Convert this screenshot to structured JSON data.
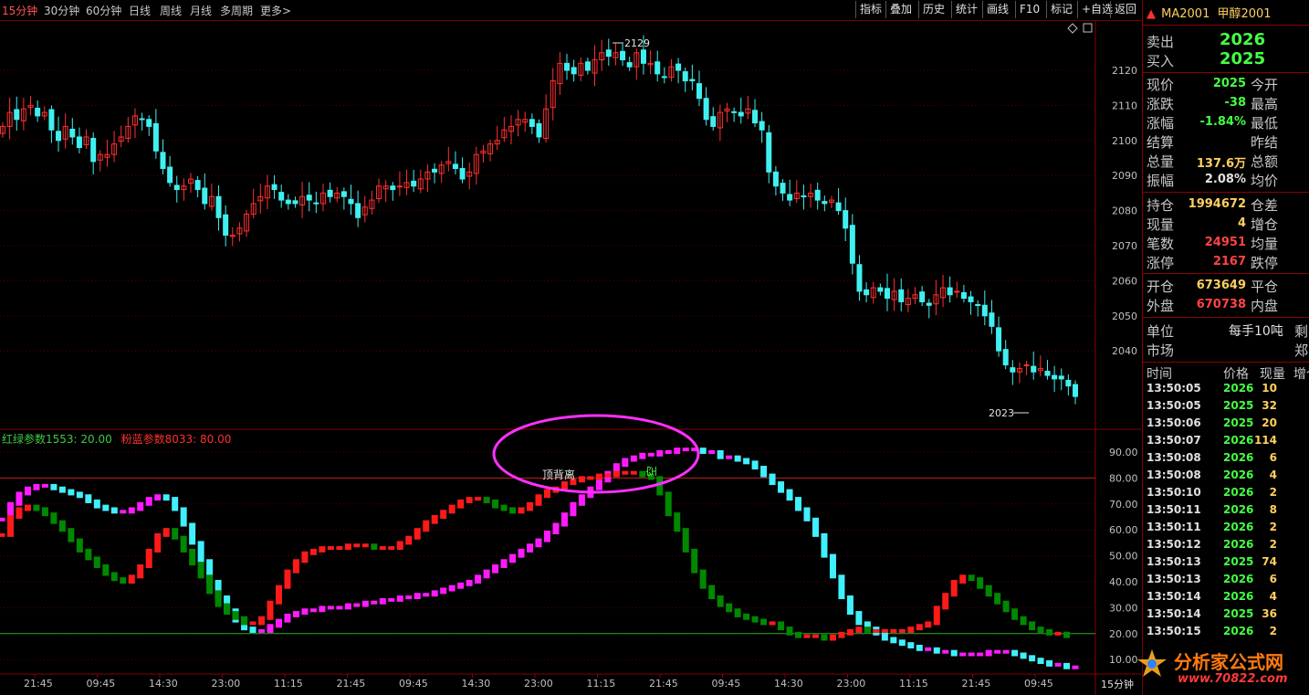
{
  "topbar": {
    "periods": [
      "15分钟",
      "30分钟",
      "60分钟",
      "日线",
      "周线",
      "月线",
      "多周期",
      "更多>"
    ],
    "tools": [
      "指标",
      "叠加",
      "历史",
      "统计",
      "画线",
      "F10",
      "标记",
      "+自选",
      "返回"
    ]
  },
  "symbol": {
    "code": "MA2001",
    "name": "甲醇2001"
  },
  "quote": {
    "sell_label": "卖出",
    "sell": "2026",
    "buy_label": "买入",
    "buy": "2025",
    "rows1": [
      {
        "l": "现价",
        "v": "2025",
        "c": "#44ff44",
        "r": "今开"
      },
      {
        "l": "涨跌",
        "v": "-38",
        "c": "#44ff44",
        "r": "最高"
      },
      {
        "l": "涨幅",
        "v": "-1.84%",
        "c": "#44ff44",
        "r": "最低"
      },
      {
        "l": "结算",
        "v": "",
        "c": "#c8c8c8",
        "r": "昨结"
      },
      {
        "l": "总量",
        "v": "137.6万",
        "c": "#ffd060",
        "r": "总额"
      },
      {
        "l": "振幅",
        "v": "2.08%",
        "c": "#e0e0e0",
        "r": "均价"
      }
    ],
    "rows2": [
      {
        "l": "持仓",
        "v": "1994672",
        "c": "#ffd060",
        "r": "仓差"
      },
      {
        "l": "现量",
        "v": "4",
        "c": "#ffd060",
        "r": "增仓"
      },
      {
        "l": "笔数",
        "v": "24951",
        "c": "#ff4444",
        "r": "均量"
      },
      {
        "l": "涨停",
        "v": "2167",
        "c": "#ff4444",
        "r": "跌停"
      }
    ],
    "rows3": [
      {
        "l": "开仓",
        "v": "673649",
        "c": "#ffd060",
        "r": "平仓"
      },
      {
        "l": "外盘",
        "v": "670738",
        "c": "#ff4444",
        "r": "内盘"
      }
    ],
    "unit_label": "单位",
    "unit_value": "每手10吨",
    "unit_right": "剩",
    "market_label": "市场",
    "market_value": "郑"
  },
  "ticks": {
    "headers": [
      "时间",
      "价格",
      "现量",
      "增仓"
    ],
    "rows": [
      {
        "t": "13:50:05",
        "p": "2026",
        "q": "10"
      },
      {
        "t": "13:50:05",
        "p": "2025",
        "q": "32"
      },
      {
        "t": "13:50:06",
        "p": "2025",
        "q": "20"
      },
      {
        "t": "13:50:07",
        "p": "2026",
        "q": "114"
      },
      {
        "t": "13:50:08",
        "p": "2026",
        "q": "6"
      },
      {
        "t": "13:50:08",
        "p": "2026",
        "q": "4"
      },
      {
        "t": "13:50:10",
        "p": "2026",
        "q": "2"
      },
      {
        "t": "13:50:11",
        "p": "2026",
        "q": "8"
      },
      {
        "t": "13:50:11",
        "p": "2026",
        "q": "2"
      },
      {
        "t": "13:50:12",
        "p": "2026",
        "q": "2"
      },
      {
        "t": "13:50:13",
        "p": "2025",
        "q": "74"
      },
      {
        "t": "13:50:13",
        "p": "2026",
        "q": "6"
      },
      {
        "t": "13:50:14",
        "p": "2026",
        "q": "4"
      },
      {
        "t": "13:50:14",
        "p": "2025",
        "q": "36"
      },
      {
        "t": "13:50:15",
        "p": "2026",
        "q": "2"
      }
    ]
  },
  "price_axis": [
    "2120",
    "2110",
    "2100",
    "2090",
    "2080",
    "2070",
    "2060",
    "2050",
    "2040"
  ],
  "indicator_axis": [
    "90.00",
    "80.00",
    "70.00",
    "60.00",
    "50.00",
    "40.00",
    "30.00",
    "20.00",
    "10.00"
  ],
  "time_axis": [
    "21:45",
    "09:45",
    "14:30",
    "23:00",
    "11:15",
    "21:45",
    "09:45",
    "14:30",
    "23:00",
    "11:15",
    "21:45",
    "09:45",
    "14:30",
    "23:00",
    "11:15",
    "21:45",
    "09:45"
  ],
  "time_axis_right": "15分钟",
  "annotations": {
    "high": "2129",
    "low": "2023",
    "divergence": "顶背离",
    "short": "空"
  },
  "indicator_title": {
    "part1": "红绿参数1553: 20.00",
    "part2": "粉蓝参数8033: 80.00"
  },
  "watermark": {
    "text": "分析家公式网",
    "url": "www.70822.com"
  },
  "colors": {
    "up": "#ff3030",
    "down": "#40f0f0",
    "red": "#ff1a1a",
    "green": "#008800",
    "magenta": "#ff1aff",
    "cyan": "#40f0ff",
    "grid": "#5a0000"
  },
  "chart_data": {
    "type": "candlestick",
    "ylim": [
      2023,
      2129
    ],
    "indicator_ylim": [
      10,
      95
    ],
    "reference_lines": [
      80,
      20
    ]
  }
}
